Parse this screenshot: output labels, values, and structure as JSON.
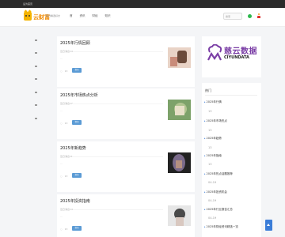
{
  "topbar": {
    "text": "设为首页"
  },
  "header": {
    "logo_text": "云财富",
    "slogan": "每日精选好文",
    "nav": [
      "首",
      "资讯",
      "财经",
      "知识"
    ],
    "search_placeholder": "搜索"
  },
  "left_nav": [
    "首",
    "财",
    "股",
    "基",
    "理",
    "债",
    "保",
    "币",
    "房",
    "企"
  ],
  "posts": [
    {
      "title": "2025年行情回顾",
      "desc": "近日消息14……………………………………………………………………………………………………",
      "desc2": "…",
      "views": "13",
      "tag": "资讯",
      "colors": [
        "#e9d3c6",
        "#6b4a3a",
        "#c98c7a"
      ]
    },
    {
      "title": "2025年市场热点分析",
      "desc": "近日消息17……………………………………………………………………………………………………",
      "desc2": "…",
      "views": "13",
      "tag": "资讯",
      "colors": [
        "#7da26a",
        "#b0c490",
        "#e7e0c8"
      ]
    },
    {
      "title": "2025年新趋势",
      "desc": "近日消息11……………………………………………………………………………………………………",
      "desc2": "…",
      "views": "13",
      "tag": "资讯",
      "colors": [
        "#222",
        "#7a6a8a",
        "#b59080"
      ]
    },
    {
      "title": "2025年投资指南",
      "desc": "近日消息14……………………………………………………………………………………………………",
      "desc2": "…",
      "views": "13",
      "tag": "资讯",
      "colors": [
        "#e6e6e6",
        "#4a4a4a",
        "#d9c8c0"
      ]
    }
  ],
  "ad": {
    "brand_cn": "慈云数据",
    "brand_en": "CIYUNDATA",
    "color": "#7b3fa6"
  },
  "sidebar": {
    "title": "热门",
    "items": [
      {
        "label": "2025年行情",
        "sub": "13"
      },
      {
        "label": "2025年市场热点",
        "sub": "13"
      },
      {
        "label": "2025年趋势",
        "sub": "13"
      },
      {
        "label": "2025年指南",
        "sub": "13"
      },
      {
        "label": "2025年热点话题推荐",
        "sub": "04-19"
      },
      {
        "label": "2025年投资机会",
        "sub": "04-19"
      },
      {
        "label": "2025年行业报告汇总",
        "sub": "04-19"
      },
      {
        "label": "2025年财经资讯精选一览",
        "sub": ""
      }
    ]
  }
}
